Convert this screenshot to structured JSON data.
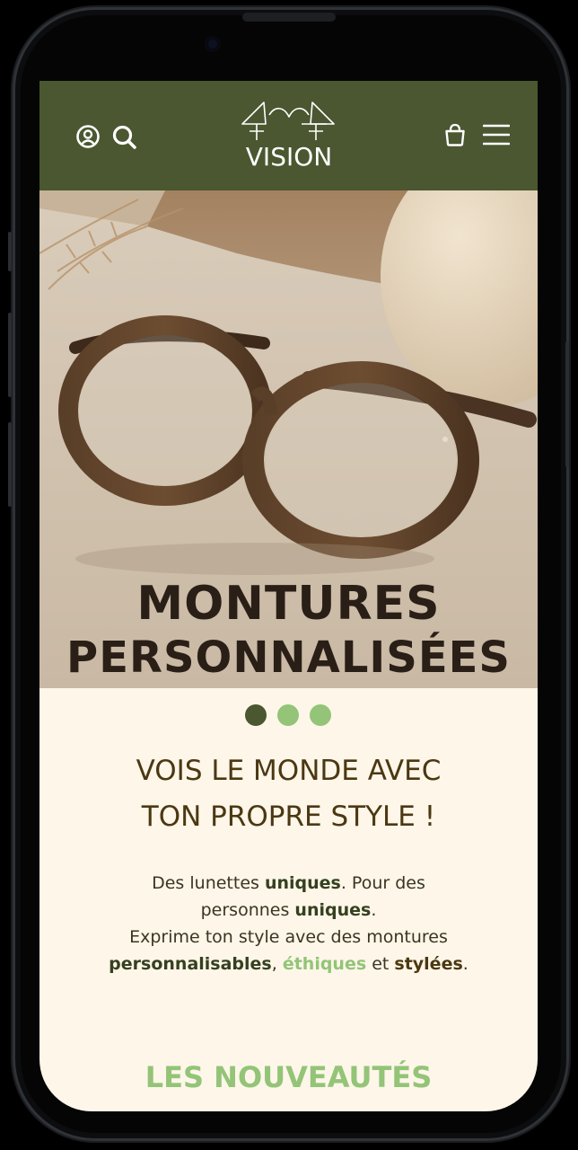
{
  "header": {
    "logo_text": "VISION",
    "icons": [
      "account-icon",
      "search-icon",
      "cart-icon",
      "menu-icon"
    ],
    "background_color": "#4a5730"
  },
  "hero": {
    "title_line1": "MONTURES",
    "title_line2": "PERSONNALISÉES",
    "carousel": {
      "total": 3,
      "active": 1
    }
  },
  "intro": {
    "headline_line1": "VOIS LE MONDE AVEC",
    "headline_line2": "TON PROPRE STYLE !",
    "p1_a": "Des lunettes ",
    "p1_b": "uniques",
    "p1_c": ". Pour des",
    "p2_a": "personnes ",
    "p2_b": "uniques",
    "p2_c": ".",
    "p3": "Exprime ton style avec des montures",
    "p4_a": "personnalisables",
    "p4_b": ", ",
    "p4_c": "éthiques",
    "p4_d": " et ",
    "p4_e": "stylées",
    "p4_f": "."
  },
  "new_section": {
    "title": "LES NOUVEAUTÉS"
  },
  "colors": {
    "accent_green": "#93c477",
    "dark_green": "#4a5730",
    "cream": "#fdf6e9",
    "headline_brown": "#4b3812"
  }
}
